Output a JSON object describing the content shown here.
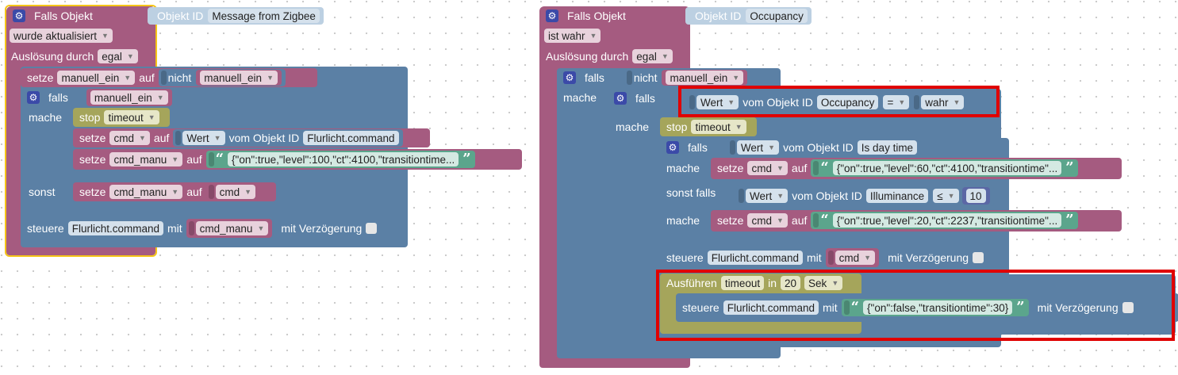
{
  "left": {
    "hat_label": "Falls Objekt",
    "objekt_id_label": "Objekt ID",
    "objekt_id_value": "Message from Zigbee",
    "trigger_value": "wurde aktualisiert",
    "ausloesung_label": "Auslösung durch",
    "ausloesung_value": "egal",
    "setze": "setze",
    "auf": "auf",
    "var_manuell": "manuell_ein",
    "nicht": "nicht",
    "falls": "falls",
    "mache": "mache",
    "stop": "stop",
    "timeout": "timeout",
    "var_cmd": "cmd",
    "wert": "Wert",
    "vom_objekt": "vom Objekt ID",
    "obj_flur_cmd": "Flurlicht.command",
    "var_cmd_manu": "cmd_manu",
    "json_long": "{\"on\":true,\"level\":100,\"ct\":4100,\"transitiontime...",
    "sonst": "sonst",
    "steuere": "steuere",
    "mit": "mit",
    "mit_verzoegerung": "mit Verzögerung"
  },
  "right": {
    "hat_label": "Falls Objekt",
    "objekt_id_label": "Objekt ID",
    "objekt_id_value": "Occupancy",
    "trigger_value": "ist wahr",
    "ausloesung_label": "Auslösung durch",
    "ausloesung_value": "egal",
    "falls": "falls",
    "nicht": "nicht",
    "var_manuell": "manuell_ein",
    "mache": "mache",
    "wert": "Wert",
    "vom_objekt": "vom Objekt ID",
    "obj_occupancy": "Occupancy",
    "eq": "=",
    "wahr": "wahr",
    "stop": "stop",
    "timeout": "timeout",
    "obj_daytime": "Is day time",
    "setze": "setze",
    "var_cmd": "cmd",
    "auf": "auf",
    "json_60": "{\"on\":true,\"level\":60,\"ct\":4100,\"transitiontime\"...",
    "sonst_falls": "sonst falls",
    "obj_illum": "Illuminance",
    "le": "≤",
    "num_10": "10",
    "json_20": "{\"on\":true,\"level\":20,\"ct\":2237,\"transitiontime\"...",
    "steuere": "steuere",
    "obj_flur_cmd": "Flurlicht.command",
    "mit": "mit",
    "mit_verzoegerung": "mit Verzögerung",
    "ausfuehren": "Ausführen",
    "in": "in",
    "num_20": "20",
    "sek": "Sek",
    "json_off": "{\"on\":false,\"transitiontime\":30}"
  },
  "colors": {
    "event": "#a55b80",
    "logic": "#5b80a5",
    "string": "#5ba58c",
    "timeout": "#a5a55b",
    "highlight_red": "#e00000",
    "selected_yellow": "#f5c518"
  }
}
